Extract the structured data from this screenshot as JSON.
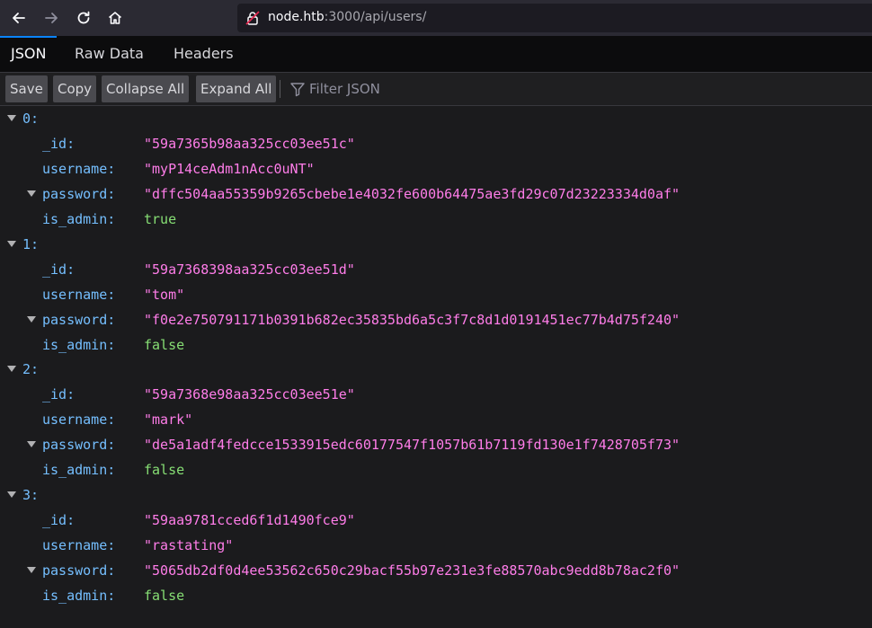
{
  "browser": {
    "url_host": "node.htb",
    "url_rest": ":3000/api/users/"
  },
  "tabs": [
    {
      "label": "JSON",
      "active": true
    },
    {
      "label": "Raw Data",
      "active": false
    },
    {
      "label": "Headers",
      "active": false
    }
  ],
  "toolbar": {
    "save": "Save",
    "copy": "Copy",
    "collapse_all": "Collapse All",
    "expand_all": "Expand All",
    "filter_placeholder": "Filter JSON"
  },
  "users": [
    {
      "index": "0:",
      "_id": "\"59a7365b98aa325cc03ee51c\"",
      "username": "\"myP14ceAdm1nAcc0uNT\"",
      "password": "\"dffc504aa55359b9265cbebe1e4032fe600b64475ae3fd29c07d23223334d0af\"",
      "is_admin": "true"
    },
    {
      "index": "1:",
      "_id": "\"59a7368398aa325cc03ee51d\"",
      "username": "\"tom\"",
      "password": "\"f0e2e750791171b0391b682ec35835bd6a5c3f7c8d1d0191451ec77b4d75f240\"",
      "is_admin": "false"
    },
    {
      "index": "2:",
      "_id": "\"59a7368e98aa325cc03ee51e\"",
      "username": "\"mark\"",
      "password": "\"de5a1adf4fedcce1533915edc60177547f1057b61b7119fd130e1f7428705f73\"",
      "is_admin": "false"
    },
    {
      "index": "3:",
      "_id": "\"59aa9781cced6f1d1490fce9\"",
      "username": "\"rastating\"",
      "password": "\"5065db2df0d4ee53562c650c29bacf55b97e231e3fe88570abc9edd8b78ac2f0\"",
      "is_admin": "false"
    }
  ],
  "keys": {
    "id": "_id:",
    "username": "username:",
    "password": "password:",
    "is_admin": "is_admin:"
  },
  "colors": {
    "key": "#75bfff",
    "string": "#ff7de9",
    "boolean": "#86de74",
    "accent": "#0a84ff"
  }
}
